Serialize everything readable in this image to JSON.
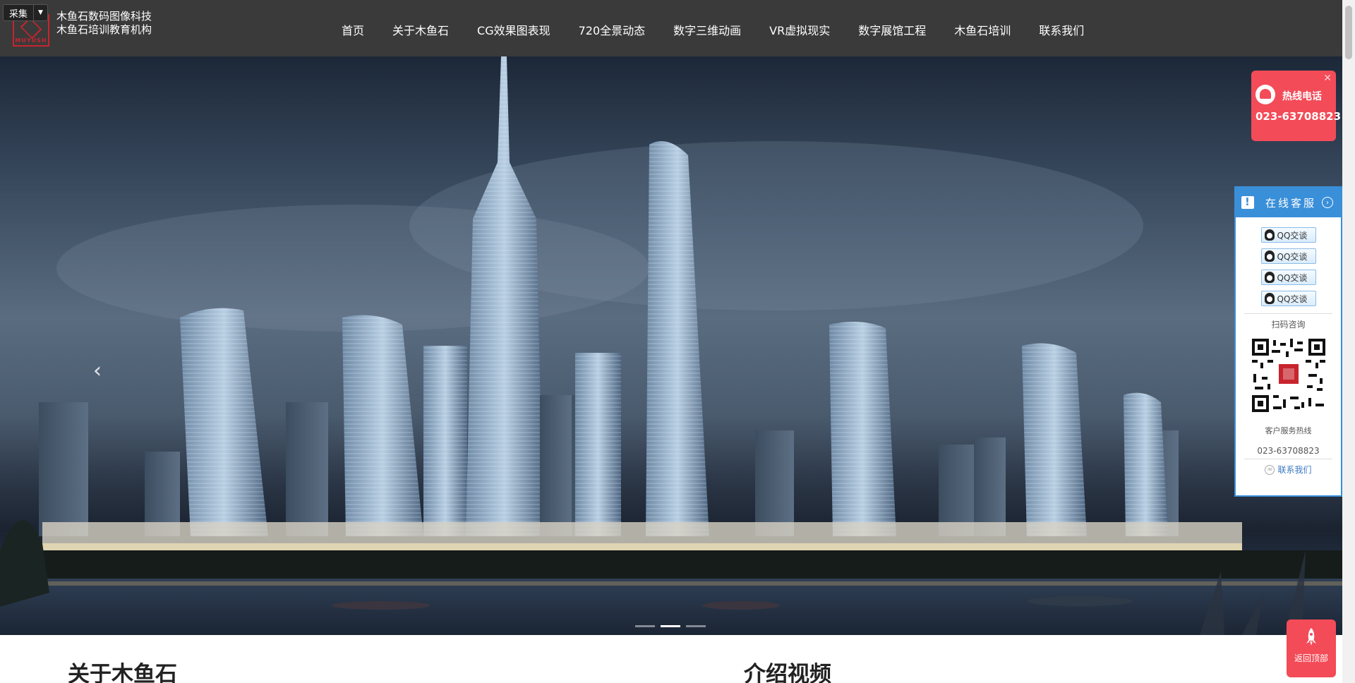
{
  "header": {
    "collect_label": "采集",
    "brand_line1": "木鱼石数码图像科技",
    "brand_line2": "木鱼石培训教育机构",
    "logo_text": "MUYUSH",
    "nav": [
      {
        "label": "首页"
      },
      {
        "label": "关于木鱼石"
      },
      {
        "label": "CG效果图表现"
      },
      {
        "label": "720全景动态"
      },
      {
        "label": "数字三维动画"
      },
      {
        "label": "VR虚拟现实"
      },
      {
        "label": "数字展馆工程"
      },
      {
        "label": "木鱼石培训"
      },
      {
        "label": "联系我们"
      }
    ]
  },
  "hero": {
    "prev_icon": "chevron-left-icon",
    "slide_count": 3,
    "active_slide": 2
  },
  "sections": {
    "about_title": "关于木鱼石",
    "video_title": "介绍视频"
  },
  "hotline": {
    "label": "热线电话",
    "number": "023-63708823",
    "close_icon": "close-icon"
  },
  "service": {
    "title": "在线客服",
    "qq_buttons": [
      {
        "label": "QQ交谈"
      },
      {
        "label": "QQ交谈"
      },
      {
        "label": "QQ交谈"
      },
      {
        "label": "QQ交谈"
      }
    ],
    "scan_label": "扫码咨询",
    "hotline_caption": "客户服务热线",
    "phone": "023-63708823",
    "contact_label": "联系我们"
  },
  "back_to_top": {
    "label": "返回顶部"
  },
  "colors": {
    "header_bg": "#3a3a3a",
    "accent_red": "#f34b58",
    "service_blue": "#3a8fd9"
  }
}
